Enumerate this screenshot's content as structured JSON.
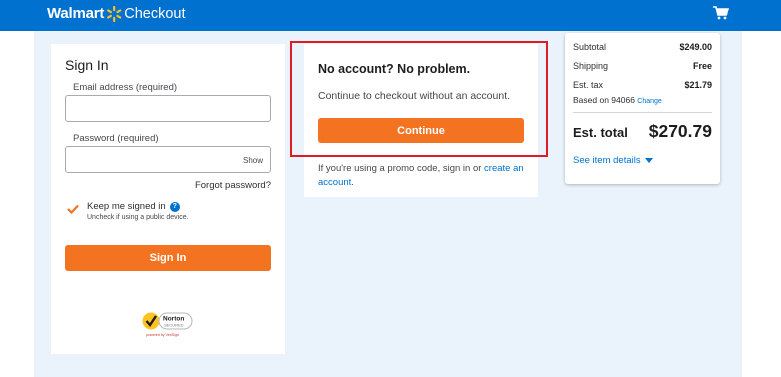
{
  "header": {
    "brand_name": "Walmart",
    "page_label": "Checkout",
    "cart_icon": "cart-icon"
  },
  "signin": {
    "title": "Sign In",
    "email_label": "Email address (required)",
    "email_value": "",
    "password_label": "Password (required)",
    "password_value": "",
    "show_label": "Show",
    "forgot_label": "Forgot password?",
    "keep_signed_in_label": "Keep me signed in",
    "keep_signed_in_checked": true,
    "info_glyph": "?",
    "uncheck_hint": "Uncheck if using a public device.",
    "sign_in_button": "Sign In",
    "norton_badge": {
      "line1": "Norton",
      "line2": "SECURED",
      "line3": "powered by VeriSign"
    }
  },
  "guest": {
    "title": "No account? No problem.",
    "subtitle": "Continue to checkout without an account.",
    "continue_button": "Continue",
    "promo_text": "If you're using a promo code, sign in or ",
    "promo_link": "create an account",
    "promo_end": "."
  },
  "summary": {
    "subtotal_label": "Subtotal",
    "subtotal_value": "$249.00",
    "shipping_label": "Shipping",
    "shipping_value": "Free",
    "tax_label": "Est. tax",
    "tax_value": "$21.79",
    "tax_basis": "Based on 94066",
    "tax_change_link": "Change",
    "total_label": "Est. total",
    "total_value": "$270.79",
    "details_link": "See item details"
  },
  "colors": {
    "header_blue": "#0071ce",
    "accent_orange": "#f47321",
    "spark_yellow": "#ffc220",
    "highlight_red": "#e11b22",
    "background_band": "#eaf2fb"
  }
}
